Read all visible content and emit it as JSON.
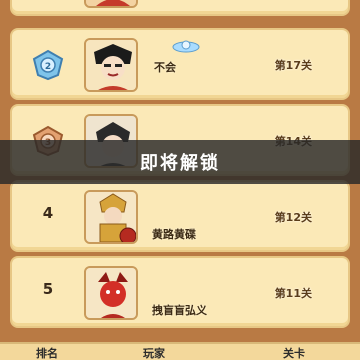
{
  "overlay": {
    "label": "即将解锁"
  },
  "rows": [
    {
      "rank": "",
      "name": "",
      "level": ""
    },
    {
      "rank": "2",
      "name": "不会",
      "level": "第17关"
    },
    {
      "rank": "3",
      "name": "",
      "level": "第14关"
    },
    {
      "rank": "4",
      "name": "黄路黄碟",
      "level": "第12关"
    },
    {
      "rank": "5",
      "name": "拽盲盲弘义",
      "level": "第11关"
    }
  ],
  "footer": {
    "col_rank": "排名",
    "col_player": "玩家",
    "col_level": "关卡"
  },
  "colors": {
    "board": "#b97a44",
    "row_bg": "#fbe9b7",
    "overlay": "#282828"
  },
  "icons": {
    "rank2": "silver-medal-icon",
    "rank3": "bronze-medal-icon",
    "badge": "blue-wings-badge-icon"
  }
}
